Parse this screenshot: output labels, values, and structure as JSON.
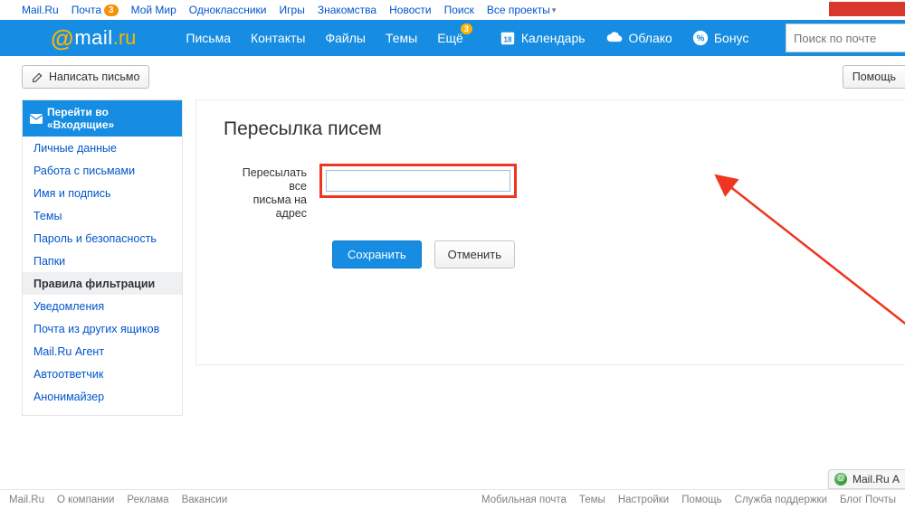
{
  "portal": {
    "items": [
      {
        "label": "Mail.Ru"
      },
      {
        "label": "Почта",
        "badge": "3"
      },
      {
        "label": "Мой Мир"
      },
      {
        "label": "Одноклассники"
      },
      {
        "label": "Игры"
      },
      {
        "label": "Знакомства"
      },
      {
        "label": "Новости"
      },
      {
        "label": "Поиск"
      },
      {
        "label": "Все проекты",
        "caret": true
      }
    ]
  },
  "header": {
    "logo_prefix": "@",
    "logo_main": "mail",
    "logo_suffix": ".ru",
    "nav": [
      {
        "label": "Письма"
      },
      {
        "label": "Контакты"
      },
      {
        "label": "Файлы"
      },
      {
        "label": "Темы"
      },
      {
        "label": "Ещё",
        "badge": "3"
      }
    ],
    "services": [
      {
        "icon": "calendar-icon",
        "label": "Календарь"
      },
      {
        "icon": "cloud-icon",
        "label": "Облако"
      },
      {
        "icon": "bonus-icon",
        "label": "Бонус"
      }
    ],
    "search_placeholder": "Поиск по почте"
  },
  "toolbar": {
    "compose": "Написать письмо",
    "help": "Помощь"
  },
  "sidebar": {
    "head_label": "Перейти во «Входящие»",
    "items": [
      {
        "label": "Личные данные"
      },
      {
        "label": "Работа с письмами"
      },
      {
        "label": "Имя и подпись"
      },
      {
        "label": "Темы"
      },
      {
        "label": "Пароль и безопасность"
      },
      {
        "label": "Папки"
      },
      {
        "label": "Правила фильтрации",
        "selected": true
      },
      {
        "label": "Уведомления"
      },
      {
        "label": "Почта из других ящиков"
      },
      {
        "label": "Mail.Ru Агент"
      },
      {
        "label": "Автоответчик"
      },
      {
        "label": "Анонимайзер"
      }
    ]
  },
  "panel": {
    "title": "Пересылка писем",
    "forward_label_line1": "Пересылать все",
    "forward_label_line2": "письма на адрес",
    "forward_value": "",
    "save": "Сохранить",
    "cancel": "Отменить"
  },
  "agent_chip": "Mail.Ru А",
  "footer": {
    "left": [
      "Mail.Ru",
      "О компании",
      "Реклама",
      "Вакансии"
    ],
    "right": [
      "Мобильная почта",
      "Темы",
      "Настройки",
      "Помощь",
      "Служба поддержки",
      "Блог Почты"
    ]
  },
  "colors": {
    "brand_blue": "#168de2",
    "brand_orange": "#ffb400",
    "link": "#05c",
    "highlight_red": "#ef3622"
  }
}
